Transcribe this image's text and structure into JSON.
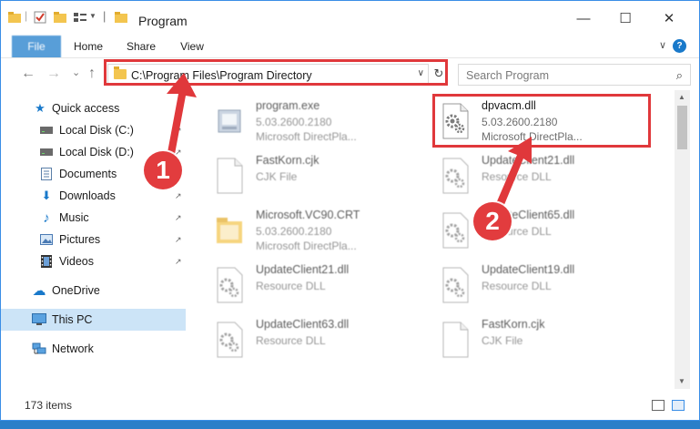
{
  "window": {
    "title": "Program",
    "controls": {
      "minimize": "—",
      "maximize": "☐",
      "close": "✕"
    }
  },
  "ribbon": {
    "tabs": [
      "File",
      "Home",
      "Share",
      "View"
    ],
    "help": "?"
  },
  "nav": {
    "back": "←",
    "forward": "→",
    "recent": "⌄",
    "up": "↑",
    "address": "C:\\Program Files\\Program Directory",
    "refresh": "↻",
    "search_placeholder": "Search Program",
    "search_icon": "⌕"
  },
  "sidebar": {
    "items": [
      {
        "label": "Quick access",
        "icon": "star-icon",
        "glyph": "★",
        "color": "#1979ca",
        "pinned": false
      },
      {
        "label": "Local Disk (C:)",
        "icon": "drive-icon",
        "glyph": "▬",
        "color": "#555555",
        "pinned": true
      },
      {
        "label": "Local Disk (D:)",
        "icon": "drive-icon",
        "glyph": "▬",
        "color": "#555555",
        "pinned": true
      },
      {
        "label": "Documents",
        "icon": "documents-icon",
        "glyph": "▤",
        "color": "#5a7fa8",
        "pinned": true
      },
      {
        "label": "Downloads",
        "icon": "download-icon",
        "glyph": "⬇",
        "color": "#1979ca",
        "pinned": true
      },
      {
        "label": "Music",
        "icon": "music-icon",
        "glyph": "♪",
        "color": "#1979ca",
        "pinned": true
      },
      {
        "label": "Pictures",
        "icon": "pictures-icon",
        "glyph": "▣",
        "color": "#4a7ab4",
        "pinned": true
      },
      {
        "label": "Videos",
        "icon": "videos-icon",
        "glyph": "▦",
        "color": "#333333",
        "pinned": true
      },
      {
        "label": "OneDrive",
        "icon": "cloud-icon",
        "glyph": "☁",
        "color": "#1979ca",
        "pinned": false
      },
      {
        "label": "This PC",
        "icon": "computer-icon",
        "glyph": "▭",
        "color": "#2e7bc4",
        "pinned": false
      },
      {
        "label": "Network",
        "icon": "network-icon",
        "glyph": "☷",
        "color": "#2e7bc4",
        "pinned": false
      }
    ],
    "pin_glyph": "↗"
  },
  "files": [
    {
      "name": "program.exe",
      "line2": "5.03.2600.2180",
      "line3": "Microsoft DirectPla...",
      "icon": "exe-icon"
    },
    {
      "name": "dpvacm.dll",
      "line2": "5.03.2600.2180",
      "line3": "Microsoft DirectPla...",
      "icon": "dll-icon"
    },
    {
      "name": "FastKorn.cjk",
      "line2": "CJK File",
      "line3": "",
      "icon": "file-icon"
    },
    {
      "name": "UpdateClient21.dll",
      "line2": "Resource DLL",
      "line3": "",
      "icon": "dll-icon"
    },
    {
      "name": "Microsoft.VC90.CRT",
      "line2": "5.03.2600.2180",
      "line3": "Microsoft DirectPla...",
      "icon": "folder-icon"
    },
    {
      "name": "UpdateClient65.dll",
      "line2": "Resource DLL",
      "line3": "",
      "icon": "dll-icon"
    },
    {
      "name": "UpdateClient21.dll",
      "line2": "Resource DLL",
      "line3": "",
      "icon": "dll-icon"
    },
    {
      "name": "UpdateClient19.dll",
      "line2": "Resource DLL",
      "line3": "",
      "icon": "dll-icon"
    },
    {
      "name": "UpdateClient63.dll",
      "line2": "Resource DLL",
      "line3": "",
      "icon": "dll-icon"
    },
    {
      "name": "FastKorn.cjk",
      "line2": "CJK File",
      "line3": "",
      "icon": "file-icon"
    }
  ],
  "status": {
    "count": "173 items"
  },
  "annotations": [
    {
      "label": "1",
      "target": "address bar"
    },
    {
      "label": "2",
      "target": "dpvacm.dll"
    }
  ],
  "colors": {
    "accent": "#1979ca",
    "highlight": "#e0383b",
    "selected_bg": "#cce4f7"
  }
}
